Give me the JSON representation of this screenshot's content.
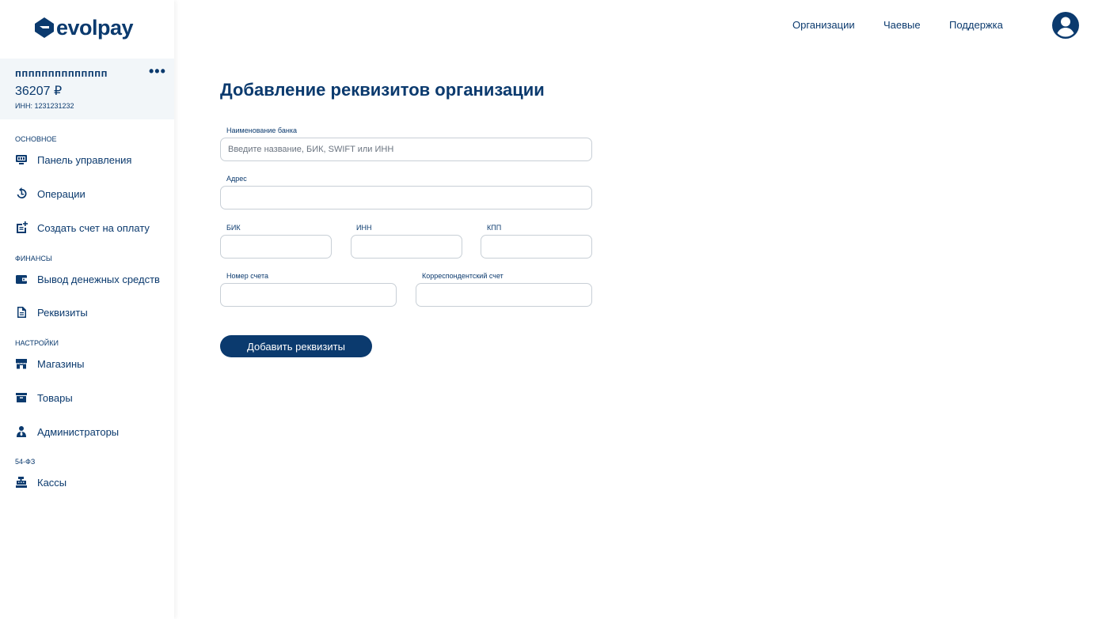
{
  "brand": {
    "name": "evolpay",
    "color": "#0b3a6e"
  },
  "account": {
    "name": "пппппппппппппп",
    "balance": "36207 ₽",
    "inn": "ИНН: 1231231232",
    "more_label": "•••"
  },
  "sidebar": {
    "sections": [
      {
        "title": "ОСНОВНОЕ"
      },
      {
        "title": "ФИНАНСЫ"
      },
      {
        "title": "НАСТРОЙКИ"
      },
      {
        "title": "54-ФЗ"
      }
    ],
    "items": [
      {
        "label": "Панель управления",
        "icon": "monitor-icon"
      },
      {
        "label": "Операции",
        "icon": "history-icon"
      },
      {
        "label": "Создать счет на оплату",
        "icon": "post-add-icon"
      },
      {
        "label": "Вывод денежных средств",
        "icon": "wallet-icon"
      },
      {
        "label": "Реквизиты",
        "icon": "document-icon"
      },
      {
        "label": "Магазины",
        "icon": "store-icon"
      },
      {
        "label": "Товары",
        "icon": "box-icon"
      },
      {
        "label": "Администраторы",
        "icon": "admin-icon"
      },
      {
        "label": "Кассы",
        "icon": "cash-register-icon"
      }
    ]
  },
  "topnav": {
    "items": [
      {
        "label": "Организации"
      },
      {
        "label": "Чаевые"
      },
      {
        "label": "Поддержка"
      }
    ],
    "avatar_icon": "account-circle-icon"
  },
  "form": {
    "title": "Добавление реквизитов организации",
    "bank": {
      "label": "Наименование банка",
      "placeholder": "Введите название, БИК, SWIFT или ИНН",
      "value": ""
    },
    "address": {
      "label": "Адрес",
      "value": ""
    },
    "bik": {
      "label": "БИК",
      "value": ""
    },
    "inn": {
      "label": "ИНН",
      "value": ""
    },
    "kpp": {
      "label": "КПП",
      "value": ""
    },
    "account_number": {
      "label": "Номер счета",
      "value": ""
    },
    "corr_account": {
      "label": "Корреспондентский счет",
      "value": ""
    },
    "submit_label": "Добавить реквизиты"
  }
}
